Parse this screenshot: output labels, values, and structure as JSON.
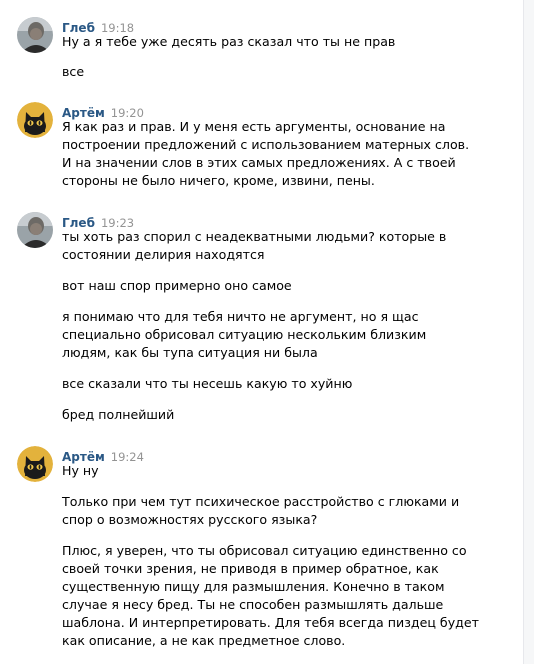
{
  "messages": [
    {
      "author": "Глеб",
      "time": "19:18",
      "avatar_icon": "person-photo-avatar",
      "lines": [
        "Ну а я тебе уже десять раз сказал что ты не прав",
        "все"
      ]
    },
    {
      "author": "Артём",
      "time": "19:20",
      "avatar_icon": "black-cat-avatar",
      "lines": [
        "Я как раз и прав. И у меня есть аргументы, основание на",
        "построении предложений с использованием матерных слов.",
        "И на значении слов в этих самых предложениях. А с твоей",
        "стороны не было ничего, кроме, извини, пены."
      ]
    },
    {
      "author": "Глеб",
      "time": "19:23",
      "avatar_icon": "person-photo-avatar",
      "lines": [
        "ты хоть раз спорил с неадекватными людьми? которые в",
        "состоянии делирия находятся",
        "вот наш спор примерно оно самое",
        "я понимаю что для тебя ничто не аргумент, но я щас",
        "специально обрисовал ситуацию нескольким близким",
        "людям, как бы тупа ситуация ни была",
        "все сказали что ты несешь какую то хуйню",
        "бред полнейший"
      ]
    },
    {
      "author": "Артём",
      "time": "19:24",
      "avatar_icon": "black-cat-avatar",
      "lines": [
        "Ну ну",
        "Только при чем тут психическое расстройство с глюками и",
        "спор о возможностях русского языка?",
        "Плюс, я уверен, что ты обрисовал ситуацию единственно со",
        "своей точки зрения, не приводя в пример обратное, как",
        "существенную пищу для размышления. Конечно в таком",
        "случае я несу бред. Ты не способен размышлять дальше",
        "шаблона. И интерпретировать. Для тебя всегда пиздец будет",
        "как описание, а не как предметное слово."
      ]
    }
  ]
}
